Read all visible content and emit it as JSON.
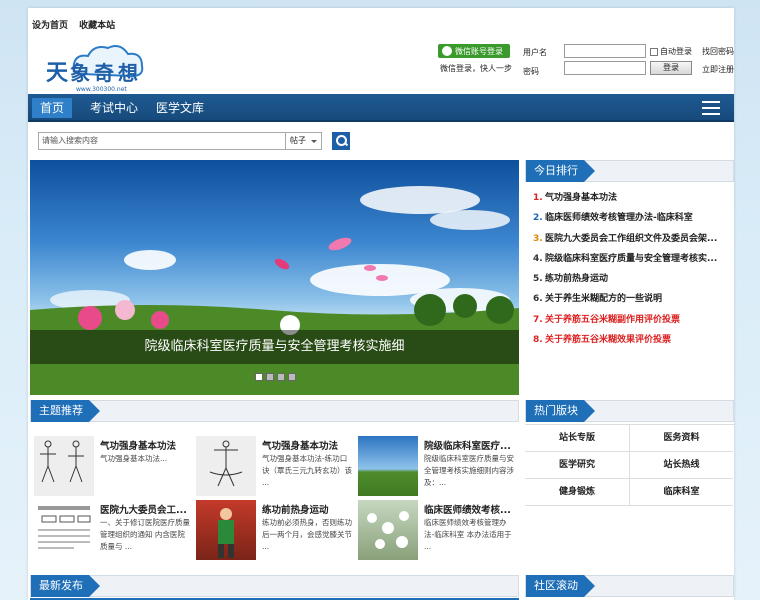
{
  "toplinks": {
    "home": "设为首页",
    "bookmark": "收藏本站"
  },
  "logo": {
    "text": "天象奇想",
    "url": "www.300300.net"
  },
  "login": {
    "wechat_btn": "微信账号登录",
    "wechat_hint": "微信登录，快人一步",
    "user_label": "用户名",
    "pass_label": "密码",
    "auto_login": "自动登录",
    "login_btn": "登录",
    "find_pwd": "找回密码",
    "register": "立即注册"
  },
  "nav": {
    "items": [
      "首页",
      "考试中心",
      "医学文库"
    ],
    "active": 0
  },
  "search": {
    "placeholder": "请输入搜索内容",
    "scope": "帖子"
  },
  "banner": {
    "caption": "院级临床科室医疗质量与安全管理考核实施细"
  },
  "ranking": {
    "title": "今日排行",
    "items": [
      {
        "n": "1.",
        "text": "气功强身基本功法",
        "color": "#d22"
      },
      {
        "n": "2.",
        "text": "临床医师绩效考核管理办法-临床科室",
        "color": "#1a64b8"
      },
      {
        "n": "3.",
        "text": "医院九大委员会工作组织文件及委员会架...",
        "color": "#e08a00"
      },
      {
        "n": "4.",
        "text": "院级临床科室医疗质量与安全管理考核实...",
        "color": "#333"
      },
      {
        "n": "5.",
        "text": "练功前热身运动",
        "color": "#333"
      },
      {
        "n": "6.",
        "text": "关于养生米糊配方的一些说明",
        "color": "#333"
      },
      {
        "n": "7.",
        "text": "关于养筋五谷米糊副作用评价投票",
        "color": "#d22",
        "text_color": "#d22"
      },
      {
        "n": "8.",
        "text": "关于养筋五谷米糊效果评价投票",
        "color": "#d22",
        "text_color": "#d22"
      }
    ]
  },
  "theme": {
    "title": "主题推荐",
    "tiles": [
      {
        "title": "气功强身基本功法",
        "desc": "气功强身基本功法..."
      },
      {
        "title": "气功强身基本功法",
        "desc": "气功强身基本功法-练功口诀（覃氏三元九转玄功）该 ..."
      },
      {
        "title": "院级临床科室医疗...",
        "desc": "院级临床科室医疗质量与安全管理考核实施细则内容涉及：..."
      },
      {
        "title": "医院九大委员会工...",
        "desc": "一、关于修订医院医疗质量管理组织的通知 内含医院质量与 ..."
      },
      {
        "title": "练功前热身运动",
        "desc": "练功前必须热身，否则练功后一两个月，会感觉膝关节 ..."
      },
      {
        "title": "临床医师绩效考核...",
        "desc": "临床医师绩效考核管理办法-临床科室 本办法适用于 ..."
      }
    ]
  },
  "hot": {
    "title": "热门版块",
    "cells": [
      "站长专版",
      "医务资料",
      "医学研究",
      "站长热线",
      "健身锻炼",
      "临床科室"
    ]
  },
  "latest": {
    "title": "最新发布"
  },
  "community": {
    "title": "社区滚动"
  }
}
